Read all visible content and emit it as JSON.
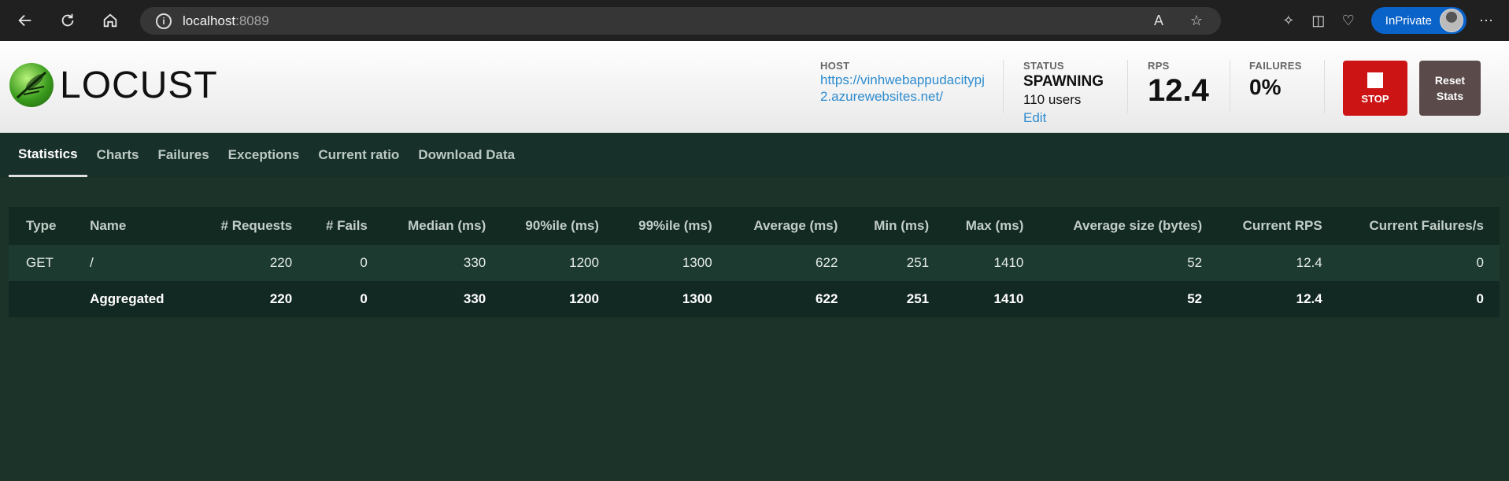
{
  "browser": {
    "url_host": "localhost",
    "url_port": ":8089",
    "inprivate_label": "InPrivate"
  },
  "header": {
    "logo_text": "LOCUST",
    "host_label": "HOST",
    "host_url": "https://vinhwebappudacitypj2.azurewebsites.net/",
    "status_label": "STATUS",
    "status_value": "SPAWNING",
    "users_text": "110 users",
    "edit_label": "Edit",
    "rps_label": "RPS",
    "rps_value": "12.4",
    "failures_label": "FAILURES",
    "failures_value": "0%",
    "stop_label": "STOP",
    "reset_label_1": "Reset",
    "reset_label_2": "Stats"
  },
  "tabs": [
    {
      "label": "Statistics",
      "active": true
    },
    {
      "label": "Charts"
    },
    {
      "label": "Failures"
    },
    {
      "label": "Exceptions"
    },
    {
      "label": "Current ratio"
    },
    {
      "label": "Download Data"
    }
  ],
  "table": {
    "columns": [
      "Type",
      "Name",
      "# Requests",
      "# Fails",
      "Median (ms)",
      "90%ile (ms)",
      "99%ile (ms)",
      "Average (ms)",
      "Min (ms)",
      "Max (ms)",
      "Average size (bytes)",
      "Current RPS",
      "Current Failures/s"
    ],
    "rows": [
      [
        "GET",
        "/",
        "220",
        "0",
        "330",
        "1200",
        "1300",
        "622",
        "251",
        "1410",
        "52",
        "12.4",
        "0"
      ],
      [
        "",
        "Aggregated",
        "220",
        "0",
        "330",
        "1200",
        "1300",
        "622",
        "251",
        "1410",
        "52",
        "12.4",
        "0"
      ]
    ]
  },
  "colors": {
    "page_bg": "#1b3328",
    "stop_red": "#cc1414",
    "reset_brown": "#5a4a4a",
    "link_blue": "#2e8ccf",
    "inprivate_blue": "#0a63c9"
  }
}
